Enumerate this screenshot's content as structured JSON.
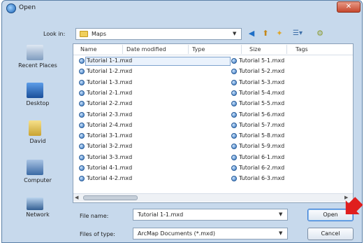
{
  "window": {
    "title": "Open",
    "close_glyph": "✕"
  },
  "toolbar": {
    "look_in_label": "Look in:",
    "look_in_value": "Maps",
    "icons": [
      "back-icon",
      "up-folder-icon",
      "new-folder-icon",
      "views-icon",
      "tools-icon"
    ]
  },
  "places": [
    {
      "label": "Recent Places",
      "icon": "recent-places-icon"
    },
    {
      "label": "Desktop",
      "icon": "desktop-icon"
    },
    {
      "label": "David",
      "icon": "user-folder-icon"
    },
    {
      "label": "Computer",
      "icon": "computer-icon"
    },
    {
      "label": "Network",
      "icon": "network-icon"
    }
  ],
  "columns": [
    "Name",
    "Date modified",
    "Type",
    "Size",
    "Tags"
  ],
  "files_col1": [
    "Tutorial 1-1.mxd",
    "Tutorial 1-2.mxd",
    "Tutorial 1-3.mxd",
    "Tutorial 2-1.mxd",
    "Tutorial 2-2.mxd",
    "Tutorial 2-3.mxd",
    "Tutorial 2-4.mxd",
    "Tutorial 3-1.mxd",
    "Tutorial 3-2.mxd",
    "Tutorial 3-3.mxd",
    "Tutorial 4-1.mxd",
    "Tutorial 4-2.mxd"
  ],
  "files_col2": [
    "Tutorial 5-1.mxd",
    "Tutorial 5-2.mxd",
    "Tutorial 5-3.mxd",
    "Tutorial 5-4.mxd",
    "Tutorial 5-5.mxd",
    "Tutorial 5-6.mxd",
    "Tutorial 5-7.mxd",
    "Tutorial 5-8.mxd",
    "Tutorial 5-9.mxd",
    "Tutorial 6-1.mxd",
    "Tutorial 6-2.mxd",
    "Tutorial 6-3.mxd"
  ],
  "selected_file": "Tutorial 1-1.mxd",
  "fields": {
    "file_name_label": "File name:",
    "file_name_value": "Tutorial 1-1.mxd",
    "file_type_label": "Files of type:",
    "file_type_value": "ArcMap Documents (*.mxd)"
  },
  "buttons": {
    "open": "Open",
    "cancel": "Cancel"
  },
  "colors": {
    "accent": "#3a7bd5",
    "pointer_arrow": "#e01e1e",
    "frame": "#c7d9ec"
  }
}
